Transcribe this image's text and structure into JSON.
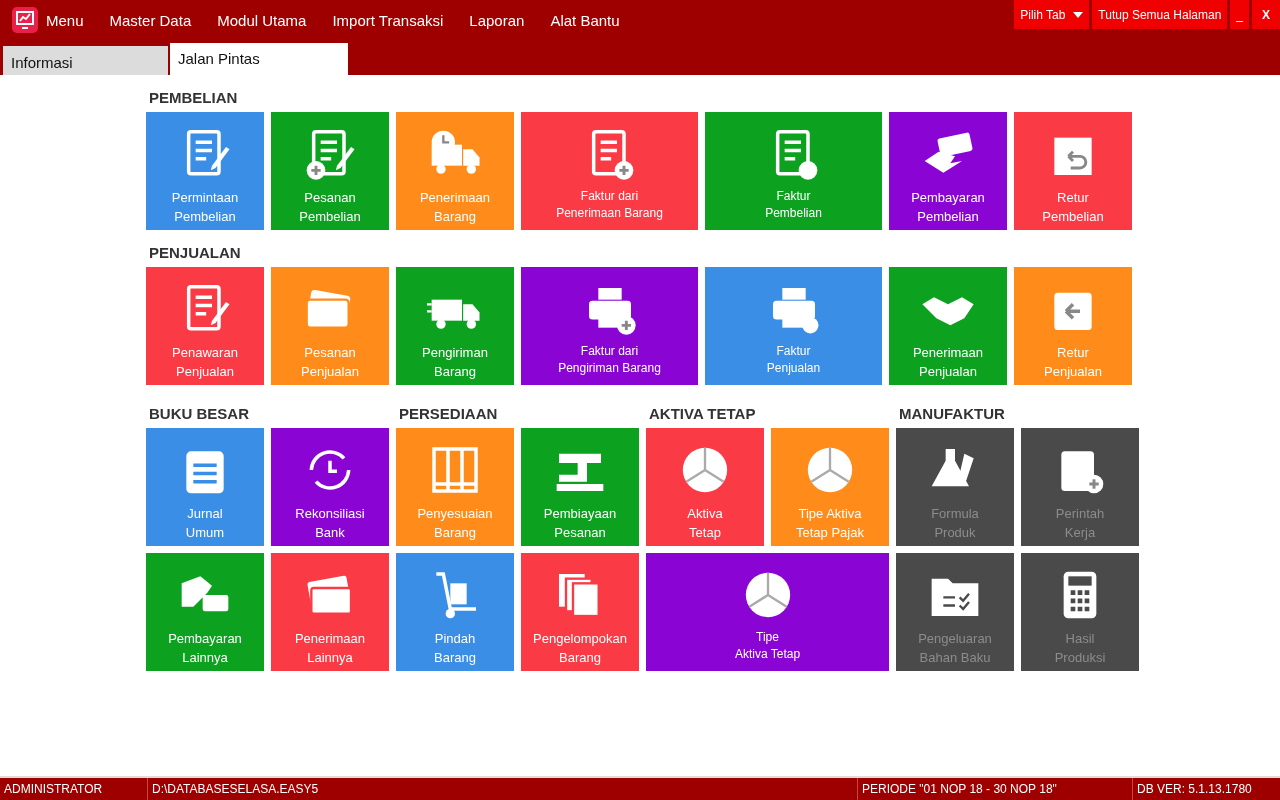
{
  "menu_bar": {
    "items": [
      "Menu",
      "Master Data",
      "Modul Utama",
      "Import Transaksi",
      "Laporan",
      "Alat Bantu"
    ],
    "buttons": [
      {
        "kind": "dropdown",
        "label": "Pilih Tab"
      },
      {
        "kind": "plain",
        "label": "Tutup Semua Halaman"
      },
      {
        "kind": "plain",
        "label": "_"
      },
      {
        "kind": "plain",
        "label": "X"
      }
    ]
  },
  "tabs": [
    {
      "label": "Informasi",
      "selected": false
    },
    {
      "label": "Jalan Pintas",
      "selected": true
    }
  ],
  "sections": [
    {
      "kind": "row",
      "title": "PEMBELIAN",
      "tiles": [
        {
          "kind": "normal",
          "label": [
            "Permintaan",
            "Pembelian"
          ],
          "color": "#3a8ee6",
          "disabled": false
        },
        {
          "kind": "normal",
          "label": [
            "Pesanan",
            "Pembelian"
          ],
          "color": "#0ca21f",
          "disabled": false
        },
        {
          "kind": "normal",
          "label": [
            "Penerimaan",
            "Barang"
          ],
          "color": "#ff8c1a",
          "disabled": false
        },
        {
          "kind": "wide",
          "label": [
            "Faktur dari",
            "Penerimaan Barang"
          ],
          "color": "#fa3a45",
          "disabled": false
        },
        {
          "kind": "wide",
          "label": [
            "Faktur",
            "Pembelian"
          ],
          "color": "#0ca21f",
          "disabled": false
        },
        {
          "kind": "normal",
          "label": [
            "Pembayaran",
            "Pembelian"
          ],
          "color": "#8a05d4",
          "disabled": false
        },
        {
          "kind": "normal",
          "label": [
            "Retur",
            "Pembelian"
          ],
          "color": "#fa3a45",
          "disabled": false
        }
      ]
    },
    {
      "kind": "row",
      "title": "PENJUALAN",
      "tiles": [
        {
          "kind": "normal",
          "label": [
            "Penawaran",
            "Penjualan"
          ],
          "color": "#fa3a45",
          "disabled": false
        },
        {
          "kind": "normal",
          "label": [
            "Pesanan",
            "Penjualan"
          ],
          "color": "#ff8c1a",
          "disabled": false
        },
        {
          "kind": "normal",
          "label": [
            "Pengiriman",
            "Barang"
          ],
          "color": "#0ca21f",
          "disabled": false
        },
        {
          "kind": "wide",
          "label": [
            "Faktur dari",
            "Pengiriman Barang"
          ],
          "color": "#8a05d4",
          "disabled": false
        },
        {
          "kind": "wide",
          "label": [
            "Faktur",
            "Penjualan"
          ],
          "color": "#3a8ee6",
          "disabled": false
        },
        {
          "kind": "normal",
          "label": [
            "Penerimaan",
            "Penjualan"
          ],
          "color": "#0ca21f",
          "disabled": false
        },
        {
          "kind": "normal",
          "label": [
            "Retur",
            "Penjualan"
          ],
          "color": "#ff8c1a",
          "disabled": false
        }
      ]
    },
    {
      "kind": "grid",
      "title": "BUKU BESAR",
      "tiles": [
        {
          "kind": "normal",
          "label": [
            "Jurnal",
            "Umum"
          ],
          "color": "#3a8ee6",
          "disabled": false
        },
        {
          "kind": "normal",
          "label": [
            "Rekonsiliasi",
            "Bank"
          ],
          "color": "#8a05d4",
          "disabled": false
        },
        {
          "kind": "normal",
          "label": [
            "Pembayaran",
            "Lainnya"
          ],
          "color": "#0ca21f",
          "disabled": false
        },
        {
          "kind": "normal",
          "label": [
            "Penerimaan",
            "Lainnya"
          ],
          "color": "#fa3a45",
          "disabled": false
        }
      ]
    },
    {
      "kind": "grid",
      "title": "PERSEDIAAN",
      "tiles": [
        {
          "kind": "normal",
          "label": [
            "Penyesuaian",
            "Barang"
          ],
          "color": "#ff8c1a",
          "disabled": false
        },
        {
          "kind": "normal",
          "label": [
            "Pembiayaan",
            "Pesanan"
          ],
          "color": "#0ca21f",
          "disabled": false
        },
        {
          "kind": "normal",
          "label": [
            "Pindah",
            "Barang"
          ],
          "color": "#3a8ee6",
          "disabled": false
        },
        {
          "kind": "normal",
          "label": [
            "Pengelompokan",
            "Barang"
          ],
          "color": "#fa3a45",
          "disabled": false
        }
      ]
    },
    {
      "kind": "grid",
      "title": "AKTIVA TETAP",
      "tiles": [
        {
          "kind": "normal",
          "label": [
            "Aktiva",
            "Tetap"
          ],
          "color": "#fa3a45",
          "disabled": false
        },
        {
          "kind": "normal",
          "label": [
            "Tipe Aktiva",
            "Tetap Pajak"
          ],
          "color": "#ff8c1a",
          "disabled": false
        },
        {
          "kind": "wide",
          "label": [
            "Tipe",
            "Aktiva Tetap"
          ],
          "color": "#8a05d4",
          "disabled": false
        }
      ]
    },
    {
      "kind": "grid",
      "title": "MANUFAKTUR",
      "tiles": [
        {
          "kind": "normal",
          "label": [
            "Formula",
            "Produk"
          ],
          "color": "#4a4a4a",
          "disabled": true
        },
        {
          "kind": "normal",
          "label": [
            "Perintah",
            "Kerja"
          ],
          "color": "#4a4a4a",
          "disabled": true
        },
        {
          "kind": "normal",
          "label": [
            "Pengeluaran",
            "Bahan Baku"
          ],
          "color": "#4a4a4a",
          "disabled": true
        },
        {
          "kind": "normal",
          "label": [
            "Hasil",
            "Produksi"
          ],
          "color": "#4a4a4a",
          "disabled": true
        }
      ]
    }
  ],
  "status_bar": [
    "ADMINISTRATOR",
    "D:\\DATABASESELASA.EASY5",
    "PERIODE \"01 NOP 18 - 30 NOP 18\"",
    "DB VER: 5.1.13.1780"
  ]
}
